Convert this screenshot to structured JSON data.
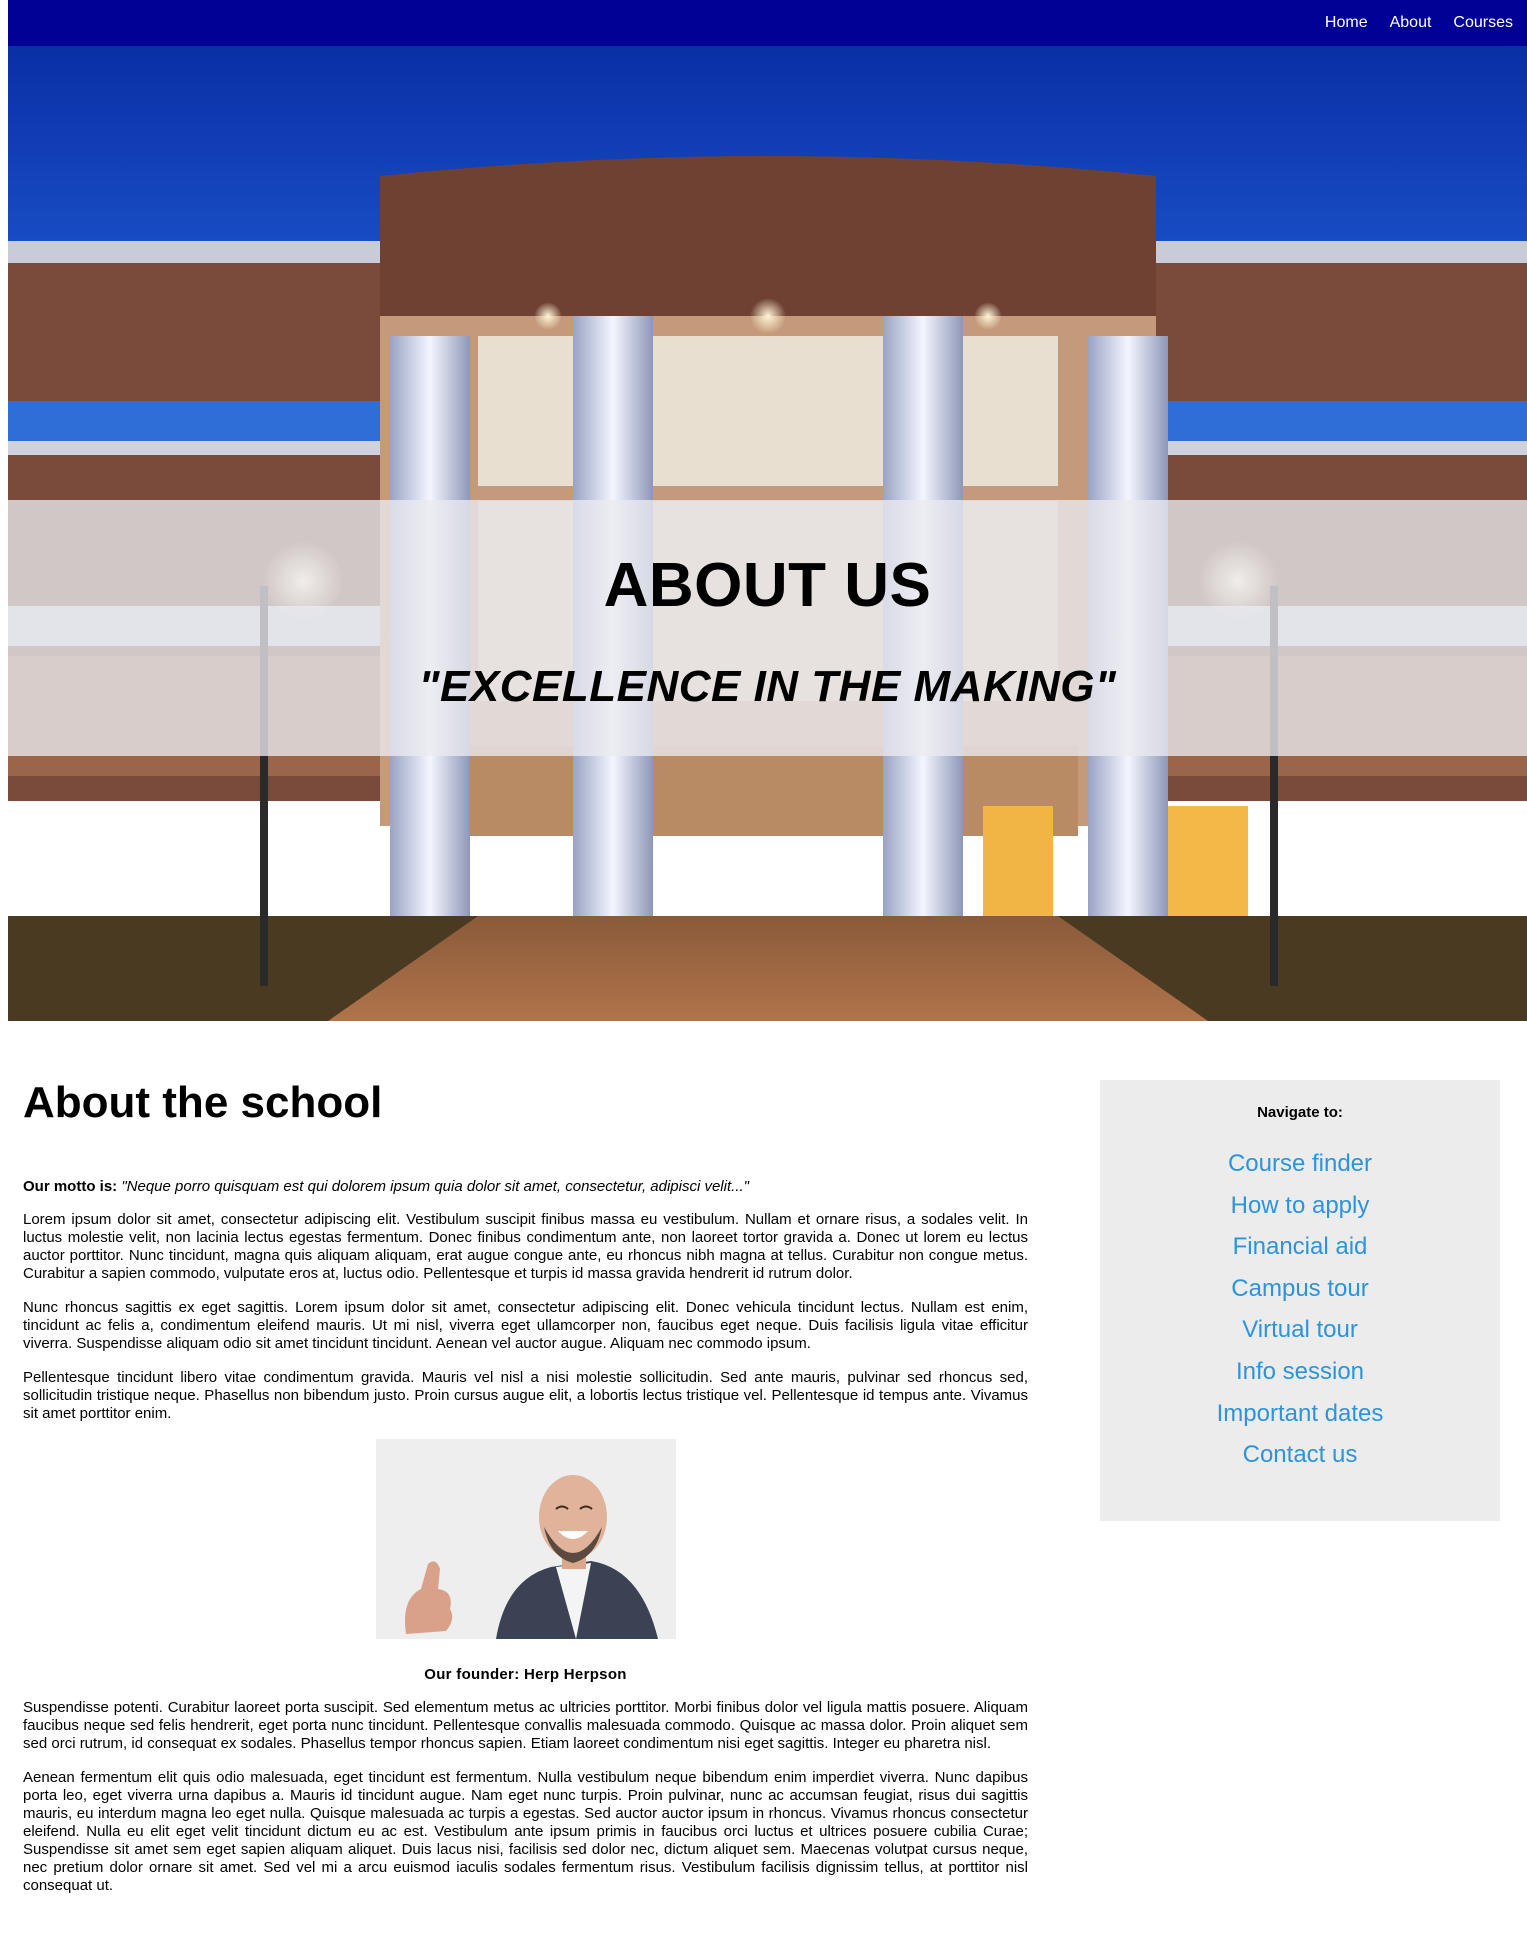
{
  "nav": {
    "links": [
      "Home",
      "About",
      "Courses"
    ]
  },
  "hero": {
    "title": "ABOUT US",
    "subtitle": "\"EXCELLENCE IN THE MAKING\""
  },
  "main": {
    "title": "About the school",
    "motto_label": "Our motto is:",
    "motto_text": "\"Neque porro quisquam est qui dolorem ipsum quia dolor sit amet, consectetur, adipisci velit...\"",
    "paragraphs_before": [
      "Lorem ipsum dolor sit amet, consectetur adipiscing elit. Vestibulum suscipit finibus massa eu vestibulum. Nullam et ornare risus, a sodales velit. In luctus molestie velit, non lacinia lectus egestas fermentum. Donec finibus condimentum ante, non laoreet tortor gravida a. Donec ut lorem eu lectus auctor porttitor. Nunc tincidunt, magna quis aliquam aliquam, erat augue congue ante, eu rhoncus nibh magna at tellus. Curabitur non congue metus. Curabitur a sapien commodo, vulputate eros at, luctus odio. Pellentesque et turpis id massa gravida hendrerit id rutrum dolor.",
      "Nunc rhoncus sagittis ex eget sagittis. Lorem ipsum dolor sit amet, consectetur adipiscing elit. Donec vehicula tincidunt lectus. Nullam est enim, tincidunt ac felis a, condimentum eleifend mauris. Ut mi nisl, viverra eget ullamcorper non, faucibus eget neque. Duis facilisis ligula vitae efficitur viverra. Suspendisse aliquam odio sit amet tincidunt tincidunt. Aenean vel auctor augue. Aliquam nec commodo ipsum.",
      "Pellentesque tincidunt libero vitae condimentum gravida. Mauris vel nisl a nisi molestie sollicitudin. Sed ante mauris, pulvinar sed rhoncus sed, sollicitudin tristique neque. Phasellus non bibendum justo. Proin cursus augue elit, a lobortis lectus tristique vel. Pellentesque id tempus ante. Vivamus sit amet porttitor enim."
    ],
    "founder_caption": "Our founder: Herp Herpson",
    "paragraphs_after": [
      "Suspendisse potenti. Curabitur laoreet porta suscipit. Sed elementum metus ac ultricies porttitor. Morbi finibus dolor vel ligula mattis posuere. Aliquam faucibus neque sed felis hendrerit, eget porta nunc tincidunt. Pellentesque convallis malesuada commodo. Quisque ac massa dolor. Proin aliquet sem sed orci rutrum, id consequat ex sodales. Phasellus tempor rhoncus sapien. Etiam laoreet condimentum nisi eget sagittis. Integer eu pharetra nisl.",
      "Aenean fermentum elit quis odio malesuada, eget tincidunt est fermentum. Nulla vestibulum neque bibendum enim imperdiet viverra. Nunc dapibus porta leo, eget viverra urna dapibus a. Mauris id tincidunt augue. Nam eget nunc turpis. Proin pulvinar, nunc ac accumsan feugiat, risus dui sagittis mauris, eu interdum magna leo eget nulla. Quisque malesuada ac turpis a egestas. Sed auctor auctor ipsum in rhoncus. Vivamus rhoncus consectetur eleifend. Nulla eu elit eget velit tincidunt dictum eu ac est. Vestibulum ante ipsum primis in faucibus orci luctus et ultrices posuere cubilia Curae; Suspendisse sit amet sem eget sapien aliquam aliquet. Duis lacus nisi, facilisis sed dolor nec, dictum aliquet sem. Maecenas volutpat cursus neque, nec pretium dolor ornare sit amet. Sed vel mi a arcu euismod iaculis sodales fermentum risus. Vestibulum facilisis dignissim tellus, at porttitor nisl consequat ut."
    ]
  },
  "sidebar": {
    "heading": "Navigate to:",
    "links": [
      "Course finder",
      "How to apply",
      "Financial aid",
      "Campus tour",
      "Virtual tour",
      "Info session",
      "Important dates",
      "Contact us"
    ]
  },
  "colors": {
    "nav_bg": "#010195",
    "sidebar_bg": "#ececec",
    "link": "#2b94de"
  }
}
